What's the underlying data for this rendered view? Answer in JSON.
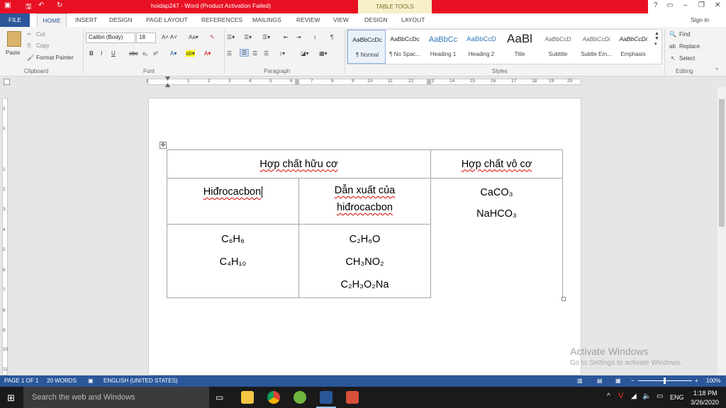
{
  "titlebar": {
    "title": "hoidap247 - Word (Product Activation Failed)",
    "context_tab": "TABLE TOOLS",
    "help": "?",
    "minimize": "–",
    "restore": "❐",
    "close": "✕",
    "sign_in": "Sign in"
  },
  "tabs": [
    "FILE",
    "HOME",
    "INSERT",
    "DESIGN",
    "PAGE LAYOUT",
    "REFERENCES",
    "MAILINGS",
    "REVIEW",
    "VIEW",
    "DESIGN",
    "LAYOUT"
  ],
  "ribbon": {
    "clipboard": {
      "paste": "Paste",
      "cut": "Cut",
      "copy": "Copy",
      "format_painter": "Format Painter",
      "group": "Clipboard"
    },
    "font": {
      "name": "Calibri (Body)",
      "size": "18",
      "group": "Font"
    },
    "paragraph": {
      "group": "Paragraph"
    },
    "styles": {
      "group": "Styles",
      "items": [
        {
          "preview": "AaBbCcDc",
          "name": "¶ Normal"
        },
        {
          "preview": "AaBbCcDc",
          "name": "¶ No Spac..."
        },
        {
          "preview": "AaBbCc",
          "name": "Heading 1"
        },
        {
          "preview": "AaBbCcD",
          "name": "Heading 2"
        },
        {
          "preview": "AaBl",
          "name": "Title"
        },
        {
          "preview": "AaBbCcD",
          "name": "Subtitle"
        },
        {
          "preview": "AaBbCcDi",
          "name": "Subtle Em..."
        },
        {
          "preview": "AaBbCcDi",
          "name": "Emphasis"
        }
      ]
    },
    "editing": {
      "find": "Find",
      "replace": "Replace",
      "select": "Select",
      "group": "Editing"
    }
  },
  "ruler": [
    "1",
    "1",
    "2",
    "3",
    "4",
    "5",
    "6",
    "7",
    "8",
    "9",
    "10",
    "11",
    "12",
    "13",
    "14",
    "15",
    "16",
    "17",
    "18",
    "19",
    "20"
  ],
  "vruler": [
    "2",
    "1",
    "1",
    "2",
    "3",
    "4",
    "5",
    "6",
    "7",
    "8",
    "9",
    "10",
    "11"
  ],
  "table": {
    "header_organic": "Hợp chất hữu cơ",
    "header_inorganic": "Hợp chất vô cơ",
    "sub_hydrocarbon": "Hiđrocacbon",
    "sub_derivative_l1": "Dẫn xuất của",
    "sub_derivative_l2": "hiđrocacbon",
    "inorganic_1": "CaCO₃",
    "inorganic_2": "NaHCO₃",
    "hydro_1": "C₆H₆",
    "hydro_2": "C₄H₁₀",
    "deriv_1": "C₂H₆O",
    "deriv_2": "CH₃NO₂",
    "deriv_3": "C₂H₃O₂Na"
  },
  "watermark": {
    "line1": "Activate Windows",
    "line2": "Go to Settings to activate Windows."
  },
  "status": {
    "page": "PAGE 1 OF 1",
    "words": "20 WORDS",
    "language": "ENGLISH (UNITED STATES)",
    "zoom": "100%"
  },
  "taskbar": {
    "search": "Search the web and Windows",
    "time": "1:18 PM",
    "date": "3/26/2020",
    "lang": "ENG"
  }
}
